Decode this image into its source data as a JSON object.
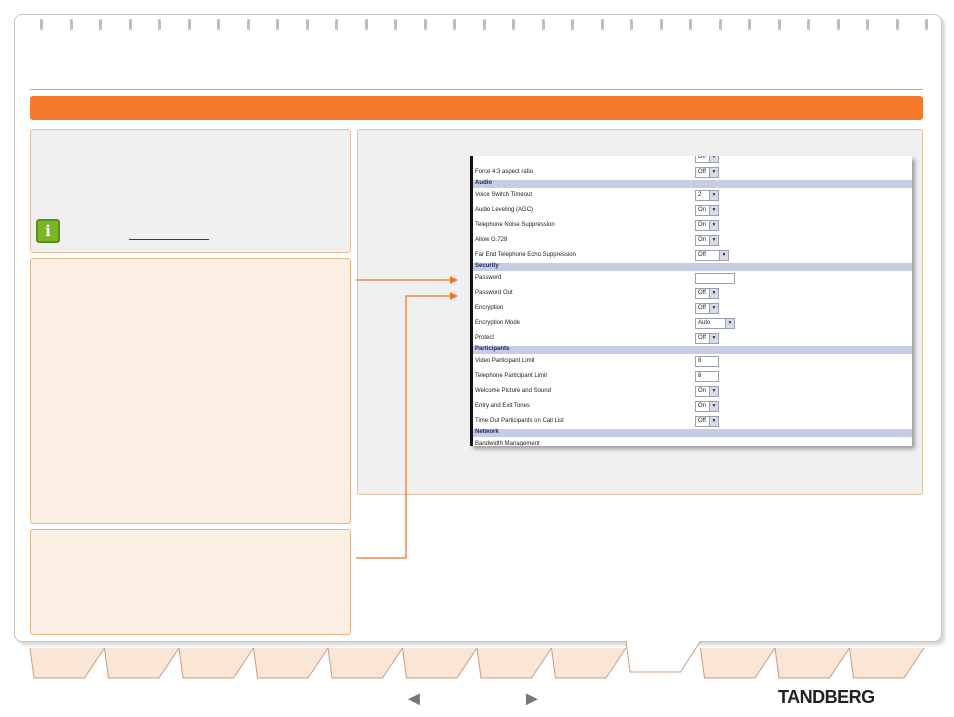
{
  "info_box": {
    "icon": "info-icon"
  },
  "screenshot": {
    "rows": [
      {
        "type": "field",
        "label": "",
        "control": "select",
        "value": "Off",
        "control_width": 22
      },
      {
        "type": "field",
        "label": "Force 4:3 aspect ratio",
        "control": "select",
        "value": "Off",
        "control_width": 22
      },
      {
        "type": "section",
        "label": "Audio"
      },
      {
        "type": "field",
        "label": "Voice Switch Timeout",
        "control": "select",
        "value": "2",
        "control_width": 22
      },
      {
        "type": "field",
        "label": "Audio Leveling (AGC)",
        "control": "select",
        "value": "On",
        "control_width": 22
      },
      {
        "type": "field",
        "label": "Telephone Noise Suppression",
        "control": "select",
        "value": "On",
        "control_width": 22
      },
      {
        "type": "field",
        "label": "Allow G.728",
        "control": "select",
        "value": "On",
        "control_width": 22
      },
      {
        "type": "field",
        "label": "Far End Telephone Echo Suppression",
        "control": "select",
        "value": "Off",
        "control_width": 32
      },
      {
        "type": "section",
        "label": "Security"
      },
      {
        "type": "field",
        "label": "Password",
        "control": "text",
        "value": "",
        "control_width": 38
      },
      {
        "type": "field",
        "label": "Password Out",
        "control": "select",
        "value": "Off",
        "control_width": 22
      },
      {
        "type": "field",
        "label": "Encryption",
        "control": "select",
        "value": "Off",
        "control_width": 22
      },
      {
        "type": "field",
        "label": "Encryption Mode",
        "control": "select",
        "value": "Auto",
        "control_width": 38
      },
      {
        "type": "field",
        "label": "Protect",
        "control": "select",
        "value": "Off",
        "control_width": 22
      },
      {
        "type": "section",
        "label": "Participants"
      },
      {
        "type": "field",
        "label": "Video Participant Limit",
        "control": "text",
        "value": "8",
        "control_width": 22
      },
      {
        "type": "field",
        "label": "Telephone Participant Limit",
        "control": "text",
        "value": "8",
        "control_width": 22
      },
      {
        "type": "field",
        "label": "Welcome Picture and Sound",
        "control": "select",
        "value": "On",
        "control_width": 22
      },
      {
        "type": "field",
        "label": "Entry and Exit Tones",
        "control": "select",
        "value": "On",
        "control_width": 22
      },
      {
        "type": "field",
        "label": "Time Out Participants on Call List",
        "control": "select",
        "value": "Off",
        "control_width": 22
      },
      {
        "type": "section",
        "label": "Network"
      },
      {
        "type": "field",
        "label": "Bandwidth Management",
        "control": "none",
        "value": ""
      }
    ]
  },
  "footer": {
    "prev_icon": "left-arrow-icon",
    "next_icon": "right-arrow-icon",
    "prev_glyph": "◄",
    "next_glyph": "►",
    "logo_text": "TANDBERG",
    "tab_count": 12,
    "active_tab": 9
  },
  "colors": {
    "accent": "#f47a2e",
    "panel_border": "#e8b48a",
    "peach": "#fcefe4",
    "grey_panel": "#f0f0f0",
    "section_bg": "#c6cce2"
  }
}
